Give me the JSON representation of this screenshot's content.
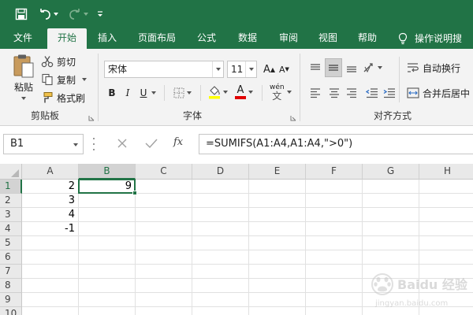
{
  "ribbon_tabs": [
    {
      "label": "文件",
      "active": false
    },
    {
      "label": "开始",
      "active": true
    },
    {
      "label": "插入",
      "active": false
    },
    {
      "label": "页面布局",
      "active": false
    },
    {
      "label": "公式",
      "active": false
    },
    {
      "label": "数据",
      "active": false
    },
    {
      "label": "审阅",
      "active": false
    },
    {
      "label": "视图",
      "active": false
    },
    {
      "label": "帮助",
      "active": false
    }
  ],
  "tell_me": "操作说明搜",
  "clipboard": {
    "paste_label": "粘贴",
    "cut_label": "剪切",
    "copy_label": "复制",
    "format_painter_label": "格式刷",
    "group_label": "剪贴板"
  },
  "font": {
    "font_name": "宋体",
    "font_size": "11",
    "grow_label": "A",
    "shrink_label": "A",
    "bold": "B",
    "italic": "I",
    "underline": "U",
    "font_color_label": "A",
    "phonetic_label": "wén",
    "group_label": "字体"
  },
  "alignment": {
    "wrap_text_label": "自动换行",
    "merge_center_label": "合并后居中",
    "group_label": "对齐方式"
  },
  "formula_bar": {
    "name_box": "B1",
    "fx_label": "fx",
    "formula": "=SUMIFS(A1:A4,A1:A4,\">0\")"
  },
  "sheet": {
    "columns": [
      "A",
      "B",
      "C",
      "D",
      "E",
      "F",
      "G",
      "H"
    ],
    "rows": [
      "1",
      "2",
      "3",
      "4",
      "5",
      "6",
      "7",
      "8",
      "9",
      "10"
    ],
    "selected_cell": "B1",
    "cells": {
      "A1": "2",
      "A2": "3",
      "A3": "4",
      "A4": "-1",
      "B1": "9"
    }
  },
  "watermark": {
    "brand": "Baidu 经验",
    "url": "jingyan.baidu.com"
  },
  "colors": {
    "accent": "#217346",
    "ribbon_bg": "#f3f3f3"
  }
}
